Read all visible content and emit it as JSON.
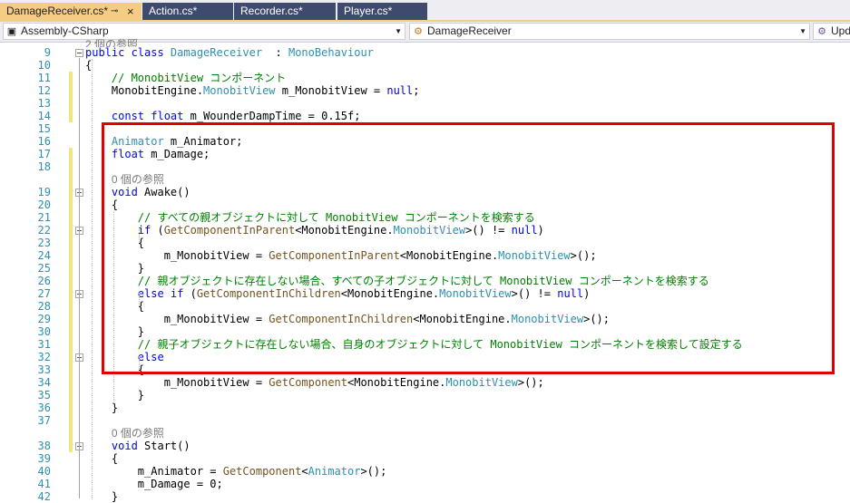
{
  "tabs": [
    {
      "label": "DamageReceiver.cs*",
      "active": true,
      "pin": "⊸",
      "close": "×"
    },
    {
      "label": "Action.cs*",
      "active": false
    },
    {
      "label": "Recorder.cs*",
      "active": false
    },
    {
      "label": "Player.cs*",
      "active": false
    }
  ],
  "nav": {
    "project": "Assembly-CSharp",
    "class": "DamageReceiver",
    "member": "Upd"
  },
  "top_ref": "2 個の参照",
  "code_lines": [
    {
      "n": "9",
      "parts": [
        [
          "kw",
          "public class "
        ],
        [
          "ty",
          "DamageReceiver"
        ],
        [
          "",
          "  : "
        ],
        [
          "ty",
          "MonoBehaviour"
        ]
      ]
    },
    {
      "n": "10",
      "parts": [
        [
          "",
          "{"
        ]
      ]
    },
    {
      "n": "11",
      "parts": [
        [
          "",
          "    "
        ],
        [
          "cm",
          "// MonobitView コンポーネント"
        ]
      ]
    },
    {
      "n": "12",
      "parts": [
        [
          "",
          "    MonobitEngine."
        ],
        [
          "ty",
          "MonobitView"
        ],
        [
          "",
          " m_MonobitView = "
        ],
        [
          "kw",
          "null"
        ],
        [
          "",
          ";"
        ]
      ]
    },
    {
      "n": "13",
      "parts": []
    },
    {
      "n": "14",
      "parts": [
        [
          "",
          "    "
        ],
        [
          "kw",
          "const float"
        ],
        [
          "",
          " m_WounderDampTime = 0.15f;"
        ]
      ]
    },
    {
      "n": "15",
      "parts": []
    },
    {
      "n": "16",
      "parts": [
        [
          "",
          "    "
        ],
        [
          "ty",
          "Animator"
        ],
        [
          "",
          " m_Animator;"
        ]
      ]
    },
    {
      "n": "17",
      "parts": [
        [
          "",
          "    "
        ],
        [
          "kw",
          "float"
        ],
        [
          "",
          " m_Damage;"
        ]
      ]
    },
    {
      "n": "18",
      "parts": []
    },
    {
      "n": "",
      "ref": "0 個の参照"
    },
    {
      "n": "19",
      "parts": [
        [
          "",
          "    "
        ],
        [
          "kw",
          "void"
        ],
        [
          "",
          " Awake()"
        ]
      ]
    },
    {
      "n": "20",
      "parts": [
        [
          "",
          "    {"
        ]
      ]
    },
    {
      "n": "21",
      "parts": [
        [
          "",
          "        "
        ],
        [
          "cm",
          "// すべての親オブジェクトに対して MonobitView コンポーネントを検索する"
        ]
      ]
    },
    {
      "n": "22",
      "parts": [
        [
          "",
          "        "
        ],
        [
          "kw",
          "if"
        ],
        [
          "",
          " ("
        ],
        [
          "mt",
          "GetComponentInParent"
        ],
        [
          "",
          "<MonobitEngine."
        ],
        [
          "ty",
          "MonobitView"
        ],
        [
          "",
          ">() != "
        ],
        [
          "kw",
          "null"
        ],
        [
          "",
          ")"
        ]
      ]
    },
    {
      "n": "23",
      "parts": [
        [
          "",
          "        {"
        ]
      ]
    },
    {
      "n": "24",
      "parts": [
        [
          "",
          "            m_MonobitView = "
        ],
        [
          "mt",
          "GetComponentInParent"
        ],
        [
          "",
          "<MonobitEngine."
        ],
        [
          "ty",
          "MonobitView"
        ],
        [
          "",
          ">();"
        ]
      ]
    },
    {
      "n": "25",
      "parts": [
        [
          "",
          "        }"
        ]
      ]
    },
    {
      "n": "26",
      "parts": [
        [
          "",
          "        "
        ],
        [
          "cm",
          "// 親オブジェクトに存在しない場合、すべての子オブジェクトに対して MonobitView コンポーネントを検索する"
        ]
      ]
    },
    {
      "n": "27",
      "parts": [
        [
          "",
          "        "
        ],
        [
          "kw",
          "else if"
        ],
        [
          "",
          " ("
        ],
        [
          "mt",
          "GetComponentInChildren"
        ],
        [
          "",
          "<MonobitEngine."
        ],
        [
          "ty",
          "MonobitView"
        ],
        [
          "",
          ">() != "
        ],
        [
          "kw",
          "null"
        ],
        [
          "",
          ")"
        ]
      ]
    },
    {
      "n": "28",
      "parts": [
        [
          "",
          "        {"
        ]
      ]
    },
    {
      "n": "29",
      "parts": [
        [
          "",
          "            m_MonobitView = "
        ],
        [
          "mt",
          "GetComponentInChildren"
        ],
        [
          "",
          "<MonobitEngine."
        ],
        [
          "ty",
          "MonobitView"
        ],
        [
          "",
          ">();"
        ]
      ]
    },
    {
      "n": "30",
      "parts": [
        [
          "",
          "        }"
        ]
      ]
    },
    {
      "n": "31",
      "parts": [
        [
          "",
          "        "
        ],
        [
          "cm",
          "// 親子オブジェクトに存在しない場合、自身のオブジェクトに対して MonobitView コンポーネントを検索して設定する"
        ]
      ]
    },
    {
      "n": "32",
      "parts": [
        [
          "",
          "        "
        ],
        [
          "kw",
          "else"
        ]
      ]
    },
    {
      "n": "33",
      "parts": [
        [
          "",
          "        {"
        ]
      ]
    },
    {
      "n": "34",
      "parts": [
        [
          "",
          "            m_MonobitView = "
        ],
        [
          "mt",
          "GetComponent"
        ],
        [
          "",
          "<MonobitEngine."
        ],
        [
          "ty",
          "MonobitView"
        ],
        [
          "",
          ">();"
        ]
      ]
    },
    {
      "n": "35",
      "parts": [
        [
          "",
          "        }"
        ]
      ]
    },
    {
      "n": "36",
      "parts": [
        [
          "",
          "    }"
        ]
      ]
    },
    {
      "n": "37",
      "parts": []
    },
    {
      "n": "",
      "ref": "0 個の参照"
    },
    {
      "n": "38",
      "parts": [
        [
          "",
          "    "
        ],
        [
          "kw",
          "void"
        ],
        [
          "",
          " Start()"
        ]
      ]
    },
    {
      "n": "39",
      "parts": [
        [
          "",
          "    {"
        ]
      ]
    },
    {
      "n": "40",
      "parts": [
        [
          "",
          "        m_Animator = "
        ],
        [
          "mt",
          "GetComponent"
        ],
        [
          "",
          "<"
        ],
        [
          "ty",
          "Animator"
        ],
        [
          "",
          ">();"
        ]
      ]
    },
    {
      "n": "41",
      "parts": [
        [
          "",
          "        m_Damage = 0;"
        ]
      ]
    },
    {
      "n": "42",
      "parts": [
        [
          "",
          "    }"
        ]
      ]
    }
  ]
}
